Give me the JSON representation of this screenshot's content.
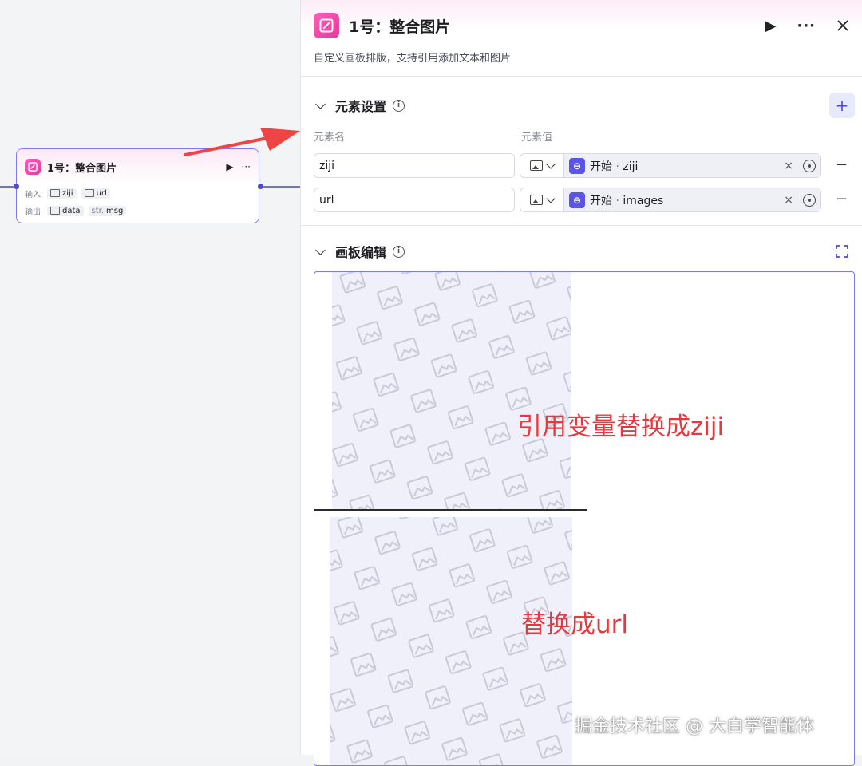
{
  "canvas": {
    "node": {
      "title": "1号：整合图片",
      "input_label": "输入",
      "output_label": "输出",
      "inputs": [
        {
          "name": "ziji"
        },
        {
          "name": "url"
        }
      ],
      "outputs": [
        {
          "name": "data",
          "type": ""
        },
        {
          "name": "msg",
          "type": "str."
        }
      ]
    }
  },
  "panel": {
    "title": "1号：整合图片",
    "description": "自定义画板排版，支持引用添加文本和图片",
    "elements_section": {
      "title": "元素设置",
      "col_name": "元素名",
      "col_value": "元素值",
      "rows": [
        {
          "name": "ziji",
          "ref_source": "开始",
          "ref_sep": " · ",
          "ref_var": "ziji"
        },
        {
          "name": "url",
          "ref_source": "开始",
          "ref_sep": " · ",
          "ref_var": "images"
        }
      ],
      "clear_symbol": "×",
      "remove_symbol": "−",
      "add_symbol": "+"
    },
    "board_section": {
      "title": "画板编辑",
      "text_top": "引用变量替换成ziji",
      "text_bottom": "替换成url"
    }
  },
  "watermark": "掘金技术社区 @ 大白学智能体",
  "colors": {
    "accent": "#5a55e6",
    "node_border": "#7d79f0",
    "annotation_red": "#e8383d",
    "arrow_red": "#ee4444",
    "app_icon_pink": "#ff5cb8"
  }
}
